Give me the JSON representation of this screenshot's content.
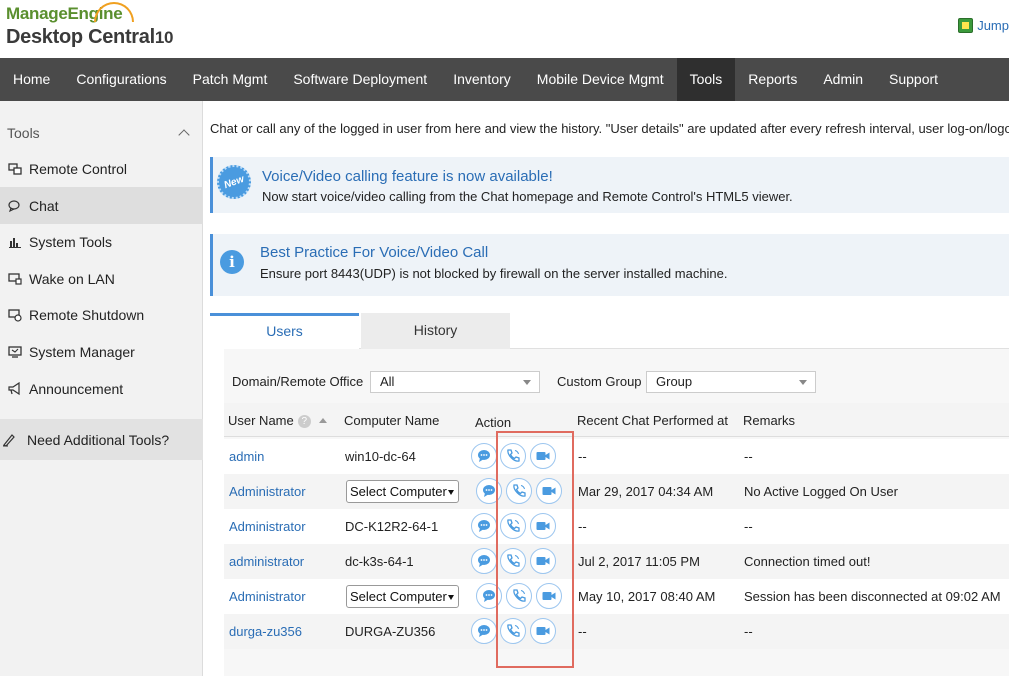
{
  "header": {
    "logo_top": "ManageEngine",
    "logo_bottom": "Desktop Central",
    "logo_version": "10",
    "jump_label": "Jump"
  },
  "nav": [
    "Home",
    "Configurations",
    "Patch Mgmt",
    "Software Deployment",
    "Inventory",
    "Mobile Device Mgmt",
    "Tools",
    "Reports",
    "Admin",
    "Support"
  ],
  "sidebar": {
    "title": "Tools",
    "items": [
      {
        "label": "Remote Control",
        "icon": "remote-control-icon"
      },
      {
        "label": "Chat",
        "icon": "chat-icon"
      },
      {
        "label": "System Tools",
        "icon": "system-tools-icon"
      },
      {
        "label": "Wake on LAN",
        "icon": "wake-on-lan-icon"
      },
      {
        "label": "Remote Shutdown",
        "icon": "remote-shutdown-icon"
      },
      {
        "label": "System Manager",
        "icon": "system-manager-icon"
      },
      {
        "label": "Announcement",
        "icon": "announcement-icon"
      }
    ],
    "extra": "Need Additional Tools?"
  },
  "main": {
    "intro": "Chat or call any of the logged in user from here and view the history. \"User details\" are updated after every refresh interval, user log-on/logoff.",
    "banner1": {
      "badge": "New",
      "title": "Voice/Video calling feature is now available!",
      "text": "Now start voice/video calling from the Chat homepage and Remote Control's HTML5 viewer."
    },
    "banner2": {
      "badge": "i",
      "title": "Best Practice For Voice/Video Call",
      "text": "Ensure port 8443(UDP) is not blocked by firewall on the server installed machine."
    },
    "tabs": [
      "Users",
      "History"
    ],
    "filters": {
      "domain_label": "Domain/Remote Office",
      "domain_value": "All",
      "group_label": "Custom Group",
      "group_value": "Group"
    },
    "columns": [
      "User Name",
      "Computer Name",
      "Action",
      "Recent Chat Performed at",
      "Remarks"
    ],
    "rows": [
      {
        "user": "admin",
        "computer": "win10-dc-64",
        "recent": "--",
        "remark": "--"
      },
      {
        "user": "Administrator",
        "computer": "Select Computer",
        "recent": "Mar 29, 2017 04:34 AM",
        "remark": "No Active Logged On User"
      },
      {
        "user": "Administrator",
        "computer": "DC-K12R2-64-1",
        "recent": "--",
        "remark": "--"
      },
      {
        "user": "administrator",
        "computer": "dc-k3s-64-1",
        "recent": "Jul 2, 2017 11:05 PM",
        "remark": "Connection timed out!"
      },
      {
        "user": "Administrator",
        "computer": "Select Computer",
        "recent": "May 10, 2017 08:40 AM",
        "remark": "Session has been disconnected at 09:02 AM"
      },
      {
        "user": "durga-zu356",
        "computer": "DURGA-ZU356",
        "recent": "--",
        "remark": "--"
      }
    ]
  },
  "colors": {
    "nav_bg": "#4a4a4a",
    "accent": "#2a6db5",
    "highlight": "#e06b5f"
  }
}
